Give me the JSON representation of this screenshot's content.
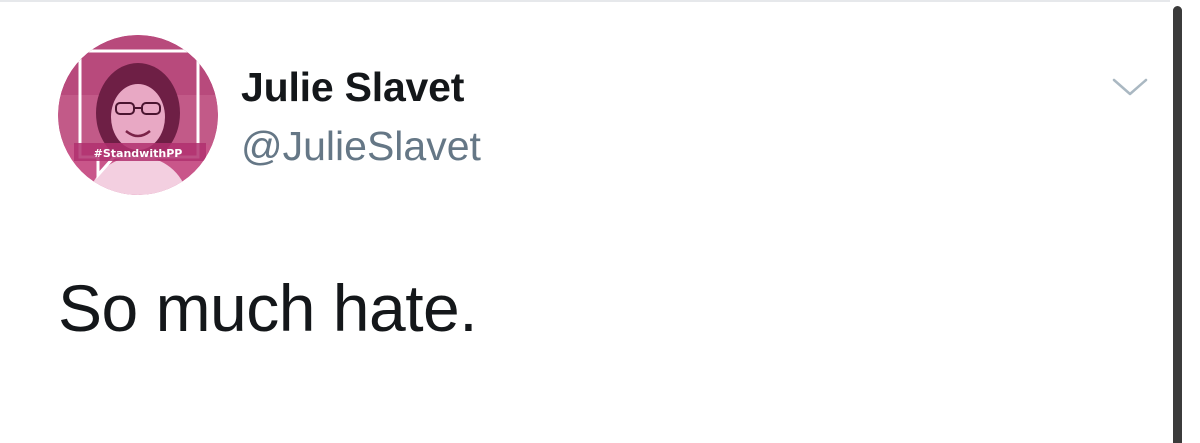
{
  "tweet": {
    "author": {
      "display_name": "Julie Slavet",
      "handle": "@JulieSlavet",
      "avatar_badge": "#StandwithPP"
    },
    "text": "So much hate.",
    "menu_icon": "chevron-down-icon"
  },
  "colors": {
    "name": "#14171a",
    "handle": "#657786",
    "avatar_tint": "#b0306e",
    "caret": "#aab8c2"
  }
}
